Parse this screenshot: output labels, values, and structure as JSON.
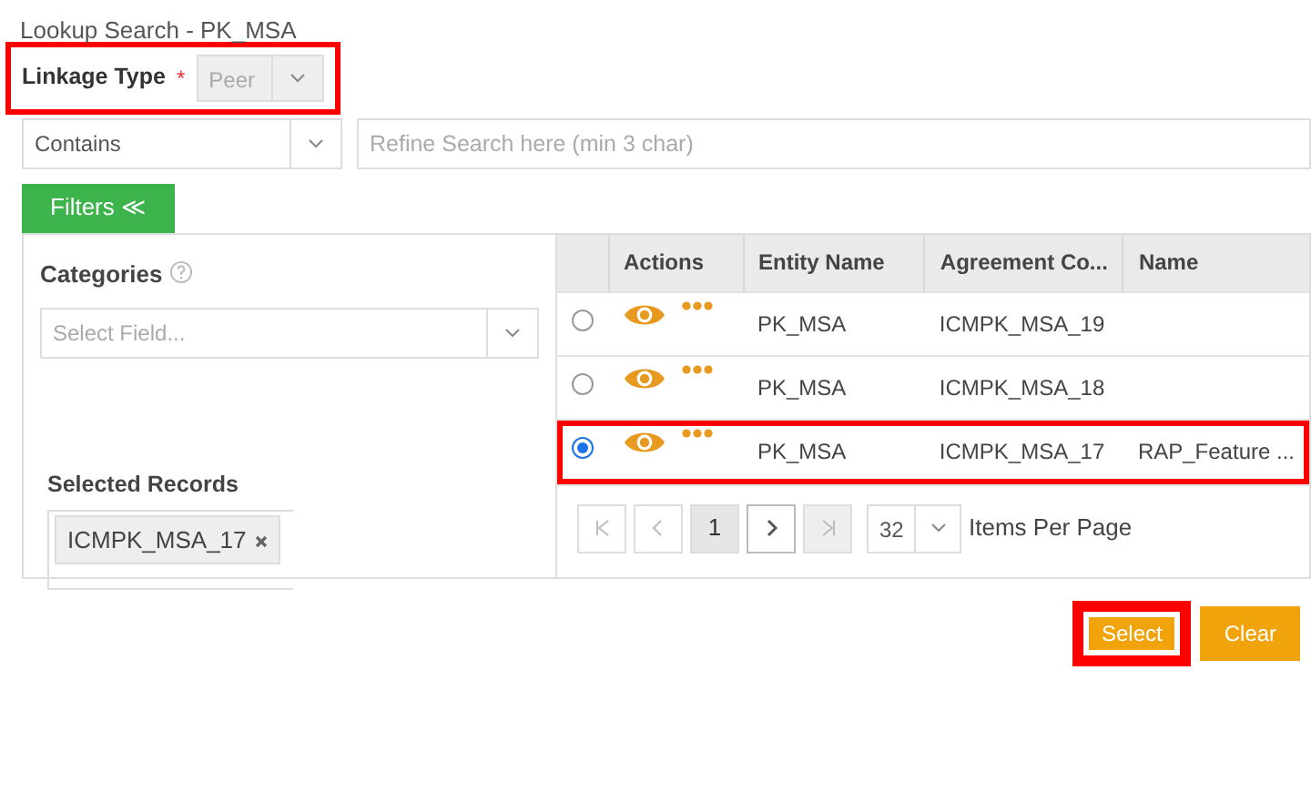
{
  "window": {
    "title": "Lookup Search - PK_MSA"
  },
  "linkage_type": {
    "label": "Linkage Type",
    "required_mark": "*",
    "value": "Peer",
    "disabled": true,
    "highlighted": true
  },
  "match_mode": {
    "value": "Contains"
  },
  "search": {
    "placeholder": "Refine Search here (min 3 char)"
  },
  "filters_tab": {
    "label": "Filters",
    "icon": "≪"
  },
  "categories": {
    "label": "Categories",
    "field_placeholder": "Select Field..."
  },
  "selected_records": {
    "label": "Selected Records",
    "chips": [
      "ICMPK_MSA_17"
    ]
  },
  "table": {
    "columns": [
      "",
      "Actions",
      "Entity Name",
      "Agreement Co...",
      "Name"
    ],
    "rows": [
      {
        "selected": false,
        "highlighted": false,
        "cells": [
          "",
          "",
          "PK_MSA",
          "ICMPK_MSA_19",
          ""
        ]
      },
      {
        "selected": false,
        "highlighted": false,
        "cells": [
          "",
          "",
          "PK_MSA",
          "ICMPK_MSA_18",
          ""
        ]
      },
      {
        "selected": true,
        "highlighted": true,
        "cells": [
          "",
          "",
          "PK_MSA",
          "ICMPK_MSA_17",
          "RAP_Feature ..."
        ]
      }
    ]
  },
  "pagination": {
    "buttons": [
      {
        "kind": "first",
        "disabled": true
      },
      {
        "kind": "prev",
        "disabled": true
      },
      {
        "kind": "page",
        "label": "1",
        "selected": true
      },
      {
        "kind": "next",
        "disabled": false
      },
      {
        "kind": "last",
        "disabled": true
      }
    ],
    "page_size": "32",
    "page_size_label": "Items Per Page"
  },
  "buttons": [
    {
      "label": "Select",
      "highlighted": true
    },
    {
      "label": "Clear",
      "highlighted": false
    }
  ]
}
